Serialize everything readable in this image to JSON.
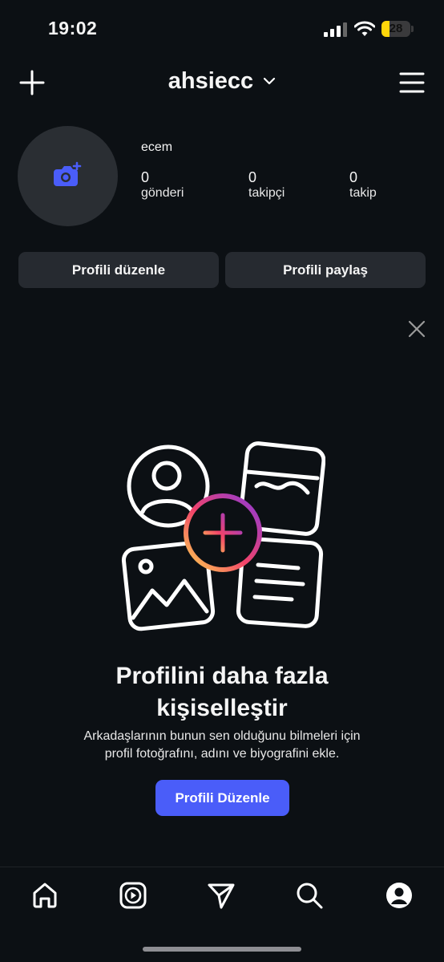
{
  "status_bar": {
    "time": "19:02",
    "battery_level": "28",
    "battery_percent": 28
  },
  "header": {
    "username": "ahsiecc"
  },
  "profile": {
    "name": "ecem",
    "stats": [
      {
        "value": "0",
        "label": "gönderi"
      },
      {
        "value": "0",
        "label": "takipçi"
      },
      {
        "value": "0",
        "label": "takip"
      }
    ]
  },
  "actions": {
    "edit_label": "Profili düzenle",
    "share_label": "Profili paylaş"
  },
  "promo": {
    "headline_line1": "Profilini daha fazla",
    "headline_line2": "kişiselleştir",
    "text_line1": "Arkadaşlarının bunun sen olduğunu bilmeleri için",
    "text_line2": "profil fotoğrafını, adını ve biyografini ekle.",
    "button_label": "Profili Düzenle"
  },
  "bottom_nav": [
    "home-icon",
    "reels-icon",
    "direct-icon",
    "search-icon",
    "profile-icon"
  ],
  "colors": {
    "background": "#0c1014",
    "accent": "#4a5df9",
    "button": "#262a30",
    "battery": "#ffd60a"
  }
}
